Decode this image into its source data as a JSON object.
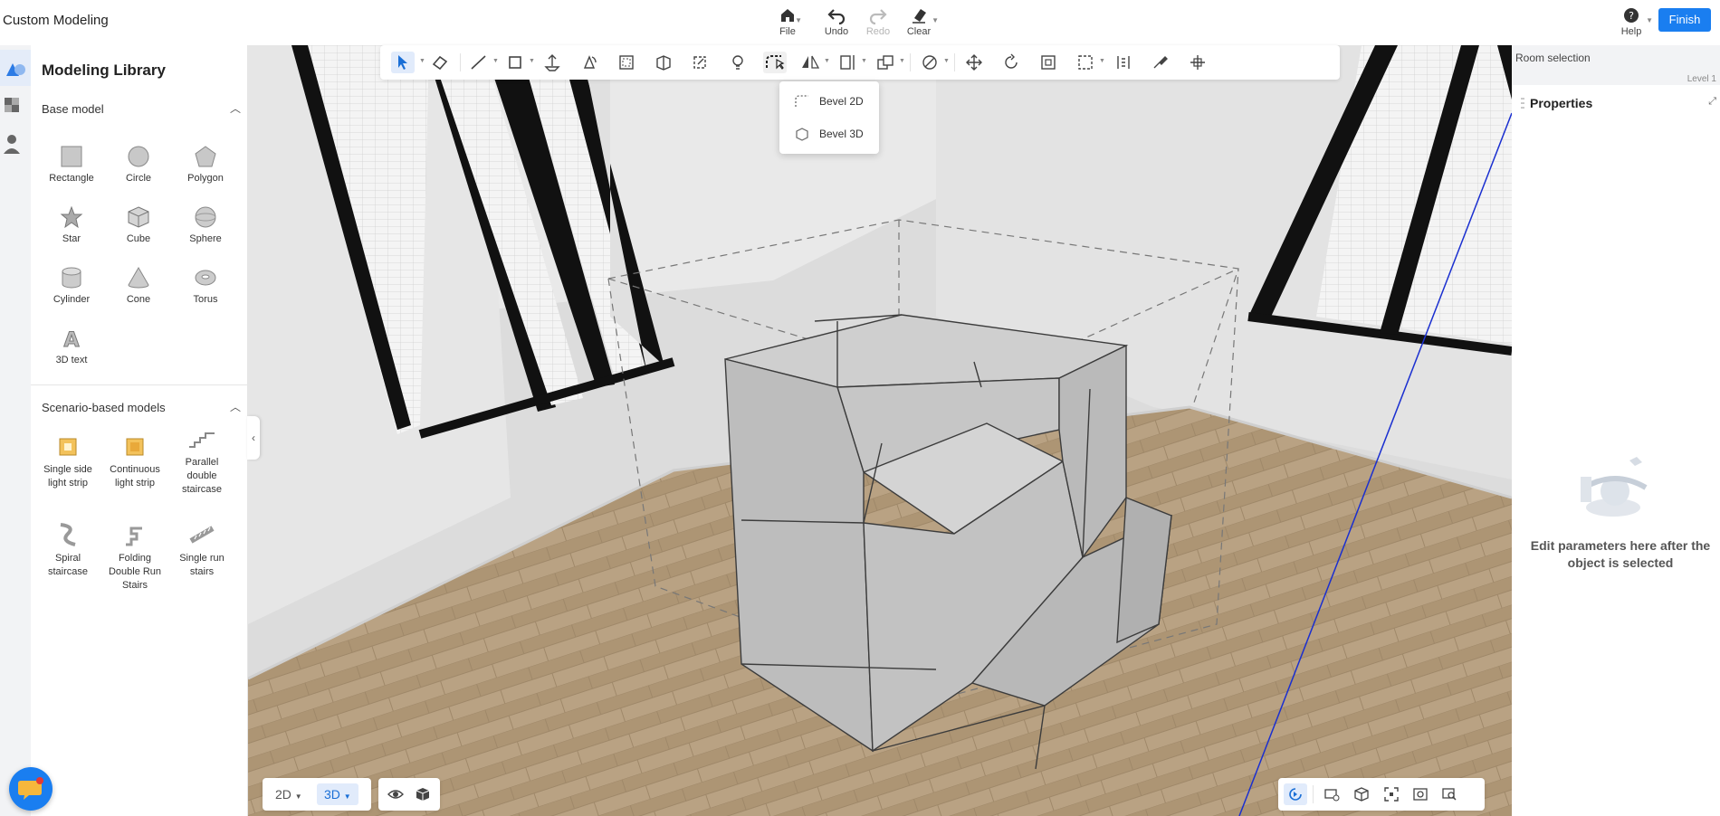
{
  "app": {
    "title": "Custom Modeling"
  },
  "header": {
    "file_label": "File",
    "undo_label": "Undo",
    "redo_label": "Redo",
    "clear_label": "Clear",
    "help_label": "Help",
    "finish_label": "Finish"
  },
  "library": {
    "title": "Modeling Library",
    "base_section": "Base model",
    "base_items": [
      "Rectangle",
      "Circle",
      "Polygon",
      "Star",
      "Cube",
      "Sphere",
      "Cylinder",
      "Cone",
      "Torus",
      "3D text"
    ],
    "scenario_section": "Scenario-based models",
    "scenario_items": [
      "Single side light strip",
      "Continuous light strip",
      "Parallel double staircase",
      "Spiral staircase",
      "Folding Double Run Stairs",
      "Single run stairs"
    ]
  },
  "toolbar": {
    "icons": [
      "select-icon",
      "eraser-icon",
      "line-icon",
      "rectangle-icon",
      "push-pull-icon",
      "rotate-shape-icon",
      "offset-icon",
      "extrude-icon",
      "path-icon",
      "lightbulb-icon",
      "bevel-icon",
      "mirror-icon",
      "align-icon",
      "boolean-icon",
      "paint-icon",
      "move-icon",
      "rotate-icon",
      "scale-icon",
      "select-area-icon",
      "measure-icon",
      "paintbrush-icon",
      "gizmo-icon"
    ],
    "bevel_menu": [
      "Bevel 2D",
      "Bevel 3D"
    ]
  },
  "right_panel": {
    "room_selection": "Room selection",
    "level": "Level 1",
    "properties_title": "Properties",
    "hint": "Edit parameters here after the object is selected"
  },
  "bottom": {
    "view_2d": "2D",
    "view_3d": "3D",
    "active_view": "3D"
  },
  "colors": {
    "accent": "#1a7ef0",
    "floor": "#b59d7c",
    "wall": "#e8e8e8",
    "cube": "#c9c9c9"
  }
}
